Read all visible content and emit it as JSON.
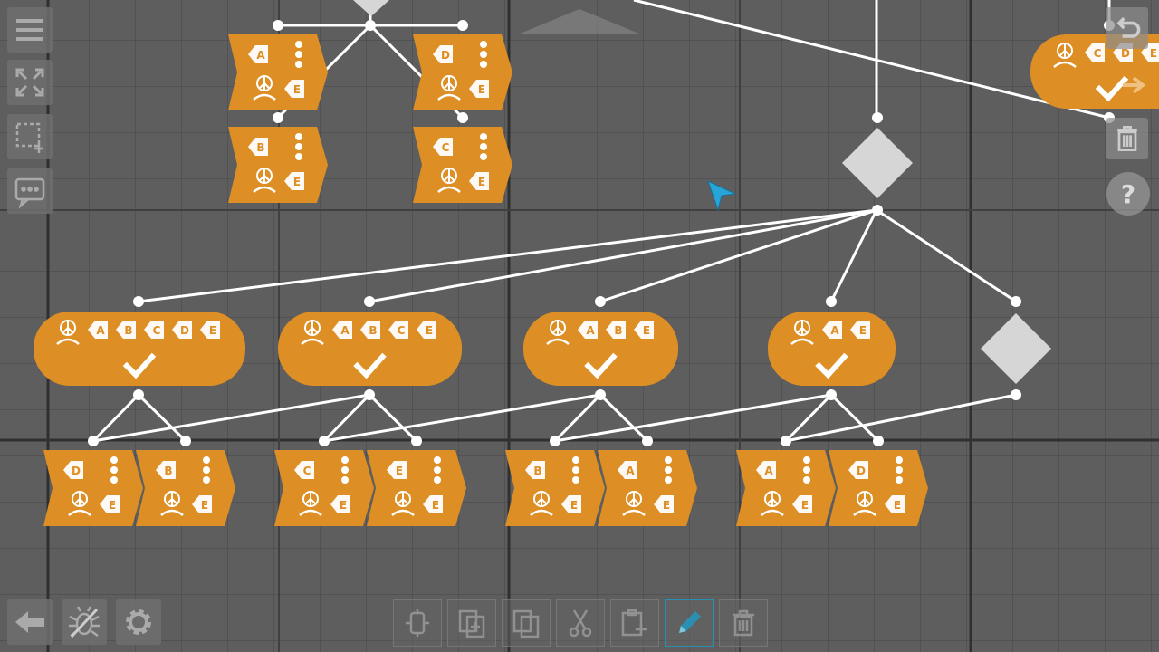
{
  "app": {
    "name": "behavior-tree-editor"
  },
  "colors": {
    "background": "#5e5e5e",
    "node": "#dd8f25",
    "link": "#ffffff",
    "decorator": "#d6d6d6",
    "active_tool": "#2a8fb0",
    "cursor": "#27a5d8"
  },
  "left_toolbar": {
    "items": [
      {
        "icon": "menu-icon"
      },
      {
        "icon": "fit-screen-icon"
      },
      {
        "icon": "select-area-icon"
      },
      {
        "icon": "comment-icon"
      }
    ]
  },
  "right_toolbar": {
    "help_label": "?",
    "items": [
      {
        "icon": "undo-icon"
      },
      {
        "icon": "trash-icon"
      },
      {
        "icon": "help-icon"
      }
    ]
  },
  "bottom_left": {
    "items": [
      {
        "icon": "back-arrow-icon"
      },
      {
        "icon": "debug-bug-icon"
      },
      {
        "icon": "settings-gear-icon"
      }
    ]
  },
  "bottom_toolbar": {
    "active": "edit",
    "items": [
      {
        "icon": "paste-node-icon"
      },
      {
        "icon": "duplicate-icon"
      },
      {
        "icon": "copy-icon"
      },
      {
        "icon": "cut-icon"
      },
      {
        "icon": "paste-icon"
      },
      {
        "icon": "edit-pencil-icon"
      },
      {
        "icon": "delete-icon"
      }
    ]
  },
  "graph": {
    "sequence_nodes": [
      {
        "tags": [
          "peace",
          "A",
          "B",
          "C",
          "D",
          "E"
        ]
      },
      {
        "tags": [
          "peace",
          "A",
          "B",
          "C",
          "E"
        ]
      },
      {
        "tags": [
          "peace",
          "A",
          "B",
          "E"
        ]
      },
      {
        "tags": [
          "peace",
          "A",
          "E"
        ]
      }
    ],
    "top_right_node": {
      "tags": [
        "peace",
        "C",
        "D",
        "E"
      ]
    },
    "action_nodes_top": [
      {
        "symbol": "A"
      },
      {
        "symbol": "D"
      },
      {
        "symbol": "B"
      },
      {
        "symbol": "C"
      }
    ],
    "action_nodes_bottom": [
      {
        "symbol": "D"
      },
      {
        "symbol": "B"
      },
      {
        "symbol": "C"
      },
      {
        "symbol": "E"
      },
      {
        "symbol": "B"
      },
      {
        "symbol": "A"
      },
      {
        "symbol": "A"
      },
      {
        "symbol": "D"
      }
    ]
  }
}
